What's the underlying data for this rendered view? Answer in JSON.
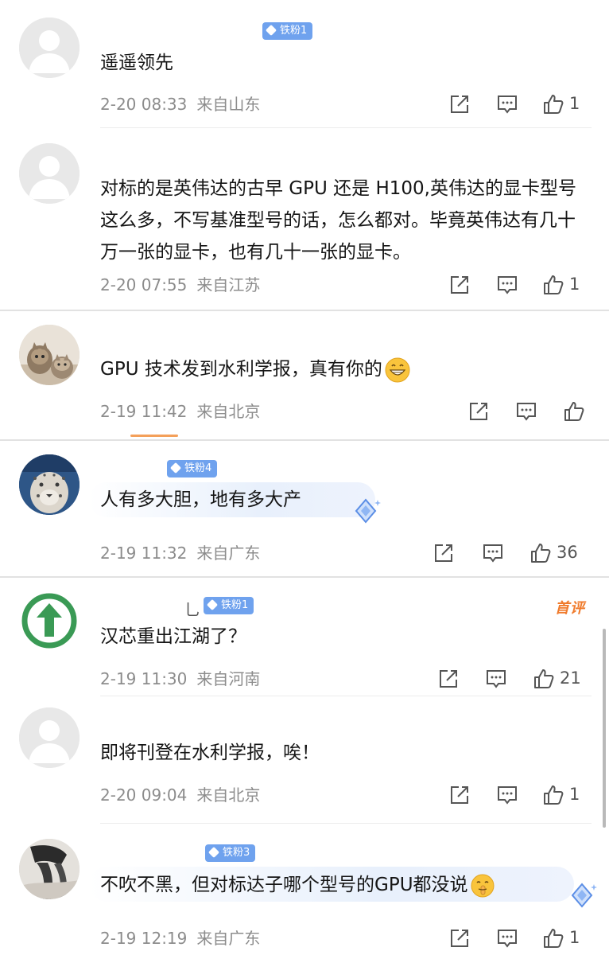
{
  "comments": [
    {
      "username": "",
      "badge": "铁粉1",
      "text": "遥遥领先",
      "date": "2-20 08:33",
      "location": "来自山东",
      "likes": "1",
      "avatar": "default-avatar"
    },
    {
      "username": "",
      "badge": "",
      "text": "对标的是英伟达的古早 GPU 还是 H100,英伟达的显卡型号这么多，不写基准型号的话，怎么都对。毕竟英伟达有几十万一张的显卡，也有几十一张的显卡。",
      "date": "2-20 07:55",
      "location": "来自江苏",
      "likes": "1",
      "avatar": "default-avatar"
    },
    {
      "username": "",
      "badge": "",
      "text": "GPU 技术发到水利学报，真有你的",
      "emoji": "grin-emoji",
      "date": "2-19 11:42",
      "location": "来自北京",
      "likes": "",
      "avatar": "cat-avatar"
    },
    {
      "username": "",
      "badge": "铁粉4",
      "text": "人有多大胆，地有多大产",
      "date": "2-19 11:32",
      "location": "来自广东",
      "likes": "36",
      "avatar": "leopard-avatar"
    },
    {
      "username": "乚",
      "badge": "铁粉1",
      "tag": "首评",
      "text": "汉芯重出江湖了？",
      "date": "2-19 11:30",
      "location": "来自河南",
      "likes": "21",
      "avatar": "green-arrow-avatar"
    },
    {
      "username": "",
      "badge": "",
      "text": "即将刊登在水利学报，唉！",
      "date": "2-20 09:04",
      "location": "来自北京",
      "likes": "1",
      "avatar": "default-avatar"
    },
    {
      "username": "",
      "badge": "铁粉3",
      "text": "不吹不黑，但对标达子哪个型号的GPU都没说",
      "emoji": "shush-emoji",
      "date": "2-19 12:19",
      "location": "来自广东",
      "likes": "1",
      "avatar": "photo-avatar"
    }
  ],
  "icons": {
    "share": "share-icon",
    "comment": "comment-icon",
    "like": "thumb-up-icon"
  },
  "colors": {
    "badge": "#6fa2ee",
    "meta": "#8c8c8c",
    "top_tag": "#f07b2c"
  }
}
